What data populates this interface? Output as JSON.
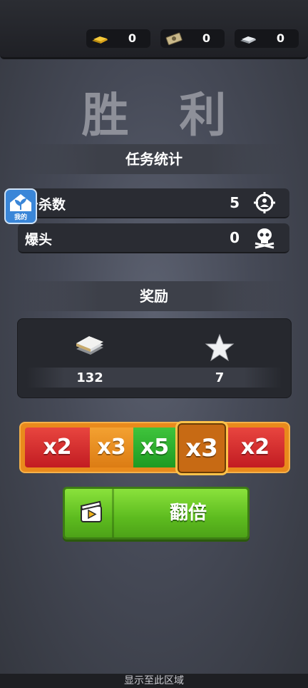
{
  "resources": [
    {
      "icon": "gold-bar-icon",
      "value": "0"
    },
    {
      "icon": "cash-bundle-icon",
      "value": "0"
    },
    {
      "icon": "silver-bar-icon",
      "value": "0"
    }
  ],
  "title": "胜 利",
  "stats": {
    "heading": "任务统计",
    "rows": [
      {
        "label": "击杀数",
        "value": "5",
        "icon": "crosshair-target-icon"
      },
      {
        "label": "爆头",
        "value": "0",
        "icon": "skull-crossbones-icon"
      }
    ]
  },
  "overlay_badge": {
    "label": "我的",
    "icon": "home-sprout-icon"
  },
  "rewards": {
    "heading": "奖励",
    "items": [
      {
        "icon": "cash-stack-icon",
        "value": "132"
      },
      {
        "icon": "star-icon",
        "value": "7"
      }
    ]
  },
  "multiplier": {
    "segments": [
      "x2",
      "x3",
      "x5",
      "x3",
      "x2"
    ],
    "selected": "x3",
    "colors": {
      "red": "#d7262c",
      "orange": "#e88a1d",
      "green": "#2fae2f",
      "frame": "#e98a1c"
    }
  },
  "double_button": {
    "label": "翻倍",
    "icon": "video-ad-icon"
  },
  "footer": {
    "text": "显示至此区域"
  }
}
